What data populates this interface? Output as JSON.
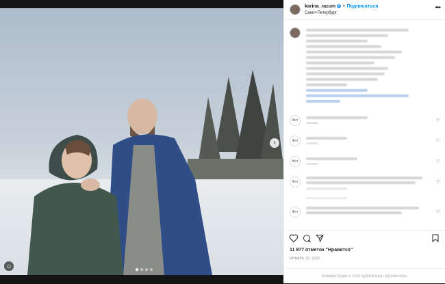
{
  "header": {
    "username": "karina_razum",
    "separator": "•",
    "follow_label": "Подписаться",
    "location": "Санкт-Петербург",
    "more_icon": "more-icon"
  },
  "photo": {
    "next_icon": "chevron-right-icon",
    "tag_icon": "user-tag-icon",
    "carousel_count": 4,
    "carousel_active": 1
  },
  "comments": {
    "avatar_label": "Фот"
  },
  "actions": {
    "icons": [
      "heart-icon",
      "comment-icon",
      "share-icon",
      "bookmark-icon"
    ]
  },
  "post": {
    "likes_text": "11 977 отметок \"Нравится\"",
    "date_text": "ЯНВАРЬ 20, 2022",
    "comments_disabled": "Комментарии к этой публикации ограничены."
  },
  "colors": {
    "accent": "#0095f6",
    "verified": "#3897f0"
  }
}
